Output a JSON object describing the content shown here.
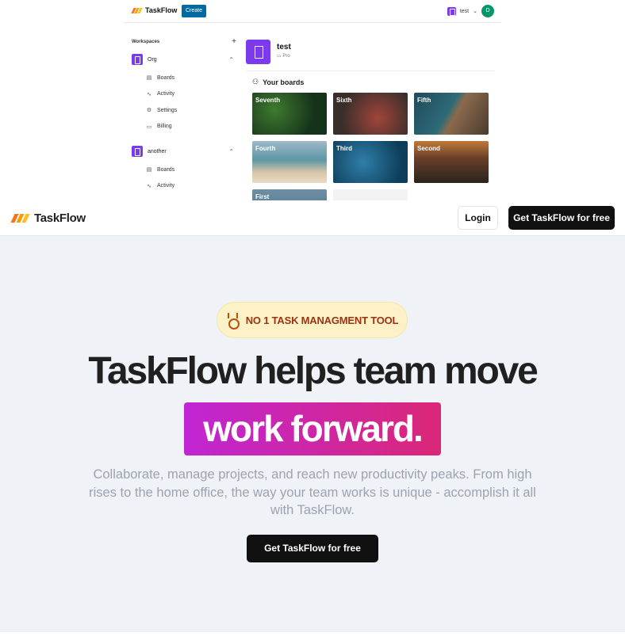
{
  "app": {
    "logo_text": "TaskFlow",
    "create_label": "Create",
    "org_switcher": "test",
    "avatar_initial": "D",
    "sidebar": {
      "title": "Workspaces",
      "add_symbol": "+",
      "workspaces": [
        {
          "name": "Org",
          "items": [
            "Boards",
            "Activity",
            "Settings",
            "Billing"
          ]
        },
        {
          "name": "another",
          "items": [
            "Boards",
            "Activity"
          ]
        }
      ]
    },
    "workspace": {
      "name": "test",
      "plan": "Pro"
    },
    "boards_heading": "Your boards",
    "boards": [
      "Seventh",
      "Sixth",
      "Fifth",
      "Fourth",
      "Third",
      "Second",
      "First",
      ""
    ]
  },
  "landing": {
    "logo_text": "TaskFlow",
    "login_label": "Login",
    "nav_cta_label": "Get TaskFlow for free",
    "badge_text": "NO 1 TASK MANAGMENT TOOL",
    "headline": "TaskFlow helps team move",
    "highlight": "work forward.",
    "subtext": "Collaborate, manage projects, and reach new productivity peaks. From high rises to the home office, the way your team works is unique - accomplish it all with TaskFlow.",
    "hero_cta_label": "Get TaskFlow for free"
  },
  "colors": {
    "accent_purple": "#7c3aed",
    "create_blue": "#0369a1",
    "highlight_start": "#c026d3",
    "highlight_end": "#db2777",
    "badge_bg": "#fdf1c7",
    "badge_text": "#9a3412",
    "hero_bg": "#eff2f7"
  }
}
